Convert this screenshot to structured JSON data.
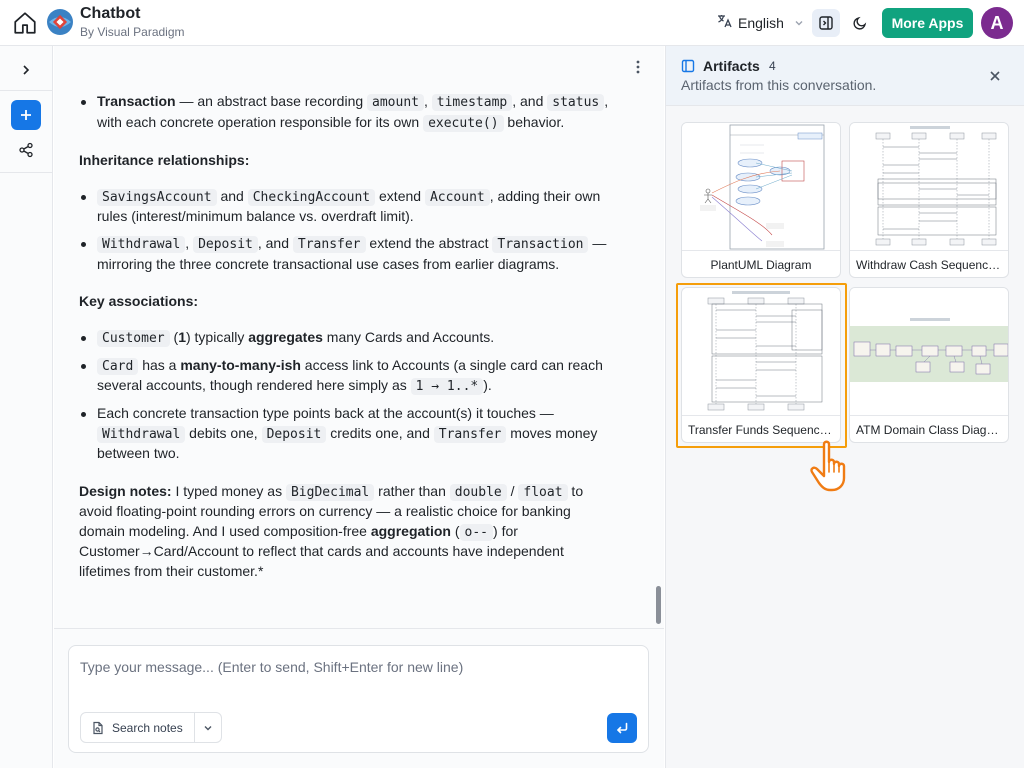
{
  "header": {
    "app_title": "Chatbot",
    "app_subtitle": "By Visual Paradigm",
    "language": "English",
    "more_apps": "More Apps",
    "avatar_initial": "A",
    "colors": {
      "more_apps_bg": "#10a37f",
      "avatar_bg": "#7b2b8f",
      "accent": "#1677e6"
    }
  },
  "rail": {
    "icons": [
      "chevron-right-icon",
      "plus-icon",
      "share-icon"
    ]
  },
  "message": {
    "transaction_label": "Transaction",
    "transaction_text_1": " — an abstract base recording ",
    "code_amount": "amount",
    "comma1": ",",
    "code_timestamp": "timestamp",
    "and1": ", and ",
    "code_status": "status",
    "transaction_text_2": ", with each concrete operation responsible for its own ",
    "code_execute": "execute()",
    "transaction_text_3": " behavior.",
    "inheritance_heading": "Inheritance relationships:",
    "inh1_code1": "SavingsAccount",
    "inh1_and": " and ",
    "inh1_code2": "CheckingAccount",
    "inh1_extend": " extend ",
    "inh1_code3": "Account",
    "inh1_rest": ", adding their own rules (interest/minimum balance vs. overdraft limit).",
    "inh2_code1": "Withdrawal",
    "inh2_comma": ",",
    "inh2_code2": "Deposit",
    "inh2_and": ", and ",
    "inh2_code3": "Transfer",
    "inh2_extend": " extend the abstract ",
    "inh2_code4": "Transaction",
    "inh2_rest": " — mirroring the three concrete transactional use cases from earlier diagrams.",
    "assoc_heading": "Key associations:",
    "assoc1_code": "Customer",
    "assoc1_text1": " (",
    "assoc1_one": "1",
    "assoc1_text2": ") typically ",
    "assoc1_bold": "aggregates",
    "assoc1_text3": " many Cards and Accounts.",
    "assoc2_code": "Card",
    "assoc2_text1": " has a ",
    "assoc2_bold": "many-to-many-ish",
    "assoc2_text2": " access link to Accounts (a single card can reach several accounts, though rendered here simply as ",
    "assoc2_code2": "1 → 1..*",
    "assoc2_text3": ").",
    "assoc3_text1": "Each concrete transaction type points back at the account(s) it touches — ",
    "assoc3_code1": "Withdrawal",
    "assoc3_text2": " debits one, ",
    "assoc3_code2": "Deposit",
    "assoc3_text3": " credits one, and ",
    "assoc3_code3": "Transfer",
    "assoc3_text4": " moves money between two.",
    "design_bold": "Design notes:",
    "design_text1": " I typed money as ",
    "design_code1": "BigDecimal",
    "design_text2": " rather than ",
    "design_code2": "double",
    "design_slash": " / ",
    "design_code3": "float",
    "design_text3": " to avoid floating-point rounding errors on currency — a realistic choice for banking domain modeling. And I used composition-free ",
    "design_bold2": "aggregation",
    "design_text4": " (",
    "design_code4": "o--",
    "design_text5": ") for Customer→Card/Account to reflect that cards and accounts have independent lifetimes from their customer.*"
  },
  "composer": {
    "placeholder": "Type your message... (Enter to send, Shift+Enter for new line)",
    "search_notes": "Search notes"
  },
  "artifacts": {
    "title": "Artifacts",
    "count": "4",
    "subtitle": "Artifacts from this conversation.",
    "items": [
      {
        "label": "PlantUML Diagram"
      },
      {
        "label": "Withdraw Cash Sequence Diagram"
      },
      {
        "label": "Transfer Funds Sequence Diagram",
        "highlighted": true
      },
      {
        "label": "ATM Domain Class Diagram"
      }
    ],
    "highlight_color": "#f59e0b"
  }
}
